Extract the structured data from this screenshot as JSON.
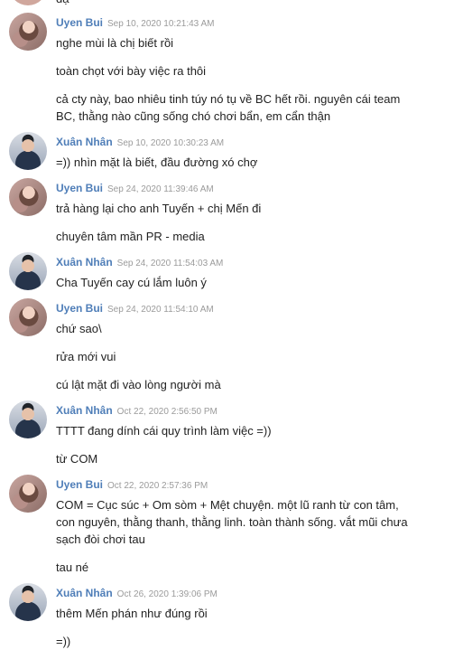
{
  "top_fragment": "đậ",
  "groups": [
    {
      "name": "Uyen Bui",
      "time": "Sep 10, 2020 10:21:43 AM",
      "messages": [
        "nghe mùi là chị biết rồi",
        "toàn chọt với bày việc ra thôi",
        "cả cty này, bao nhiêu tinh túy nó tụ về BC hết rồi. nguyên cái team BC, thằng nào cũng sống chó chơi bẩn, em cẩn thận"
      ]
    },
    {
      "name": "Xuân Nhân",
      "time": "Sep 10, 2020 10:30:23 AM",
      "messages": [
        "=)) nhìn mặt là biết, đầu đường xó chợ"
      ]
    },
    {
      "name": "Uyen Bui",
      "time": "Sep 24, 2020 11:39:46 AM",
      "messages": [
        "trả hàng lại cho anh Tuyến + chị Mến đi",
        "chuyên tâm mần PR - media"
      ]
    },
    {
      "name": "Xuân Nhân",
      "time": "Sep 24, 2020 11:54:03 AM",
      "messages": [
        "Cha Tuyến cay cú lắm luôn ý"
      ]
    },
    {
      "name": "Uyen Bui",
      "time": "Sep 24, 2020 11:54:10 AM",
      "messages": [
        "chứ sao\\",
        "rửa mới vui",
        "cú lật mặt đi vào lòng người mà"
      ]
    },
    {
      "name": "Xuân Nhân",
      "time": "Oct 22, 2020 2:56:50 PM",
      "messages": [
        "TTTT đang dính cái quy trình làm việc =))",
        "từ COM"
      ]
    },
    {
      "name": "Uyen Bui",
      "time": "Oct 22, 2020 2:57:36 PM",
      "messages": [
        "COM = Cục súc + Om sòm + Mệt chuyện. một lũ ranh từ con tâm, con nguyên, thằng thanh, thằng linh. toàn thành sống. vắt mũi chưa sạch đòi chơi tau",
        "tau né"
      ]
    },
    {
      "name": "Xuân Nhân",
      "time": "Oct 26, 2020 1:39:06 PM",
      "messages": [
        " thêm Mến phán như đúng rồi",
        "=))"
      ]
    }
  ]
}
